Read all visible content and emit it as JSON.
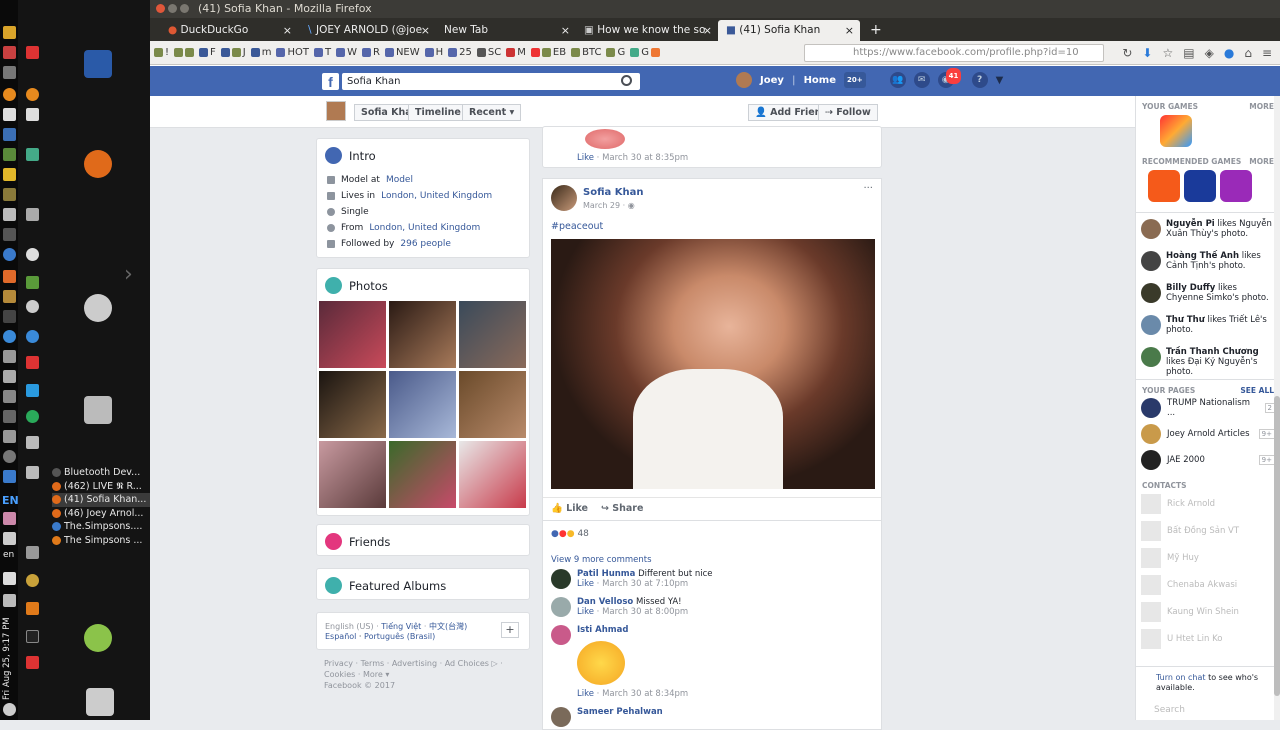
{
  "window": {
    "title": "(41) Sofia Khan - Mozilla Firefox"
  },
  "tabs": [
    {
      "label": "DuckDuckGo",
      "active": false
    },
    {
      "label": "JOEY ARNOLD (@joe",
      "active": false
    },
    {
      "label": "New Tab",
      "active": false
    },
    {
      "label": "How we know the so",
      "active": false
    },
    {
      "label": "(41) Sofia Khan",
      "active": true
    }
  ],
  "bookmarks": [
    "!",
    "F",
    "J",
    "m",
    "HOT",
    "T",
    "W",
    "R",
    "NEW",
    "H",
    "25",
    "SC",
    "M",
    "EB",
    "BTC",
    "G",
    "G"
  ],
  "url": {
    "host": "https://www.facebook.com",
    "path": "/profile.php?id=10"
  },
  "fb": {
    "search_value": "Sofia Khan",
    "user": "Joey",
    "home": "Home",
    "home_count": "20+",
    "notif_count": "41",
    "profile_name": "Sofia Khan",
    "timeline": "Timeline",
    "recent": "Recent",
    "add_friend": "Add Friend",
    "follow": "Follow"
  },
  "intro": {
    "title": "Intro",
    "rows": [
      {
        "pre": "Model at ",
        "link": "Model"
      },
      {
        "pre": "Lives in ",
        "link": "London, United Kingdom"
      },
      {
        "pre": "Single",
        "link": ""
      },
      {
        "pre": "From ",
        "link": "London, United Kingdom"
      },
      {
        "pre": "Followed by ",
        "link": "296 people"
      }
    ]
  },
  "photos": {
    "title": "Photos"
  },
  "friends": {
    "title": "Friends"
  },
  "albums": {
    "title": "Featured Albums"
  },
  "footer": {
    "langs": [
      "English (US)",
      "Tiếng Việt",
      "中文(台灣)",
      "Español",
      "Português (Brasil)"
    ],
    "plus": "+",
    "links": [
      "Privacy",
      "Terms",
      "Advertising",
      "Ad Choices",
      "Cookies",
      "More"
    ],
    "copyright": "Facebook © 2017"
  },
  "prev_post": {
    "like": "Like",
    "time": "March 30 at 8:35pm"
  },
  "post": {
    "author": "Sofia Khan",
    "date": "March 29",
    "more": "···",
    "hashtag": "#peaceout",
    "like": "Like",
    "share": "Share",
    "reaction_count": "48",
    "view_more": "View 9 more comments"
  },
  "comments": [
    {
      "name": "Patil Hunma",
      "text": "Different but nice",
      "like": "Like",
      "time": "March 30 at 7:10pm"
    },
    {
      "name": "Dan Velloso",
      "text": "Missed YA!",
      "like": "Like",
      "time": "March 30 at 8:00pm"
    },
    {
      "name": "Isti Ahmad",
      "text": "",
      "like": "Like",
      "time": "March 30 at 8:34pm"
    },
    {
      "name": "Sameer Pehalwan",
      "text": "",
      "like": "",
      "time": ""
    }
  ],
  "right": {
    "your_games": "YOUR GAMES",
    "more1": "MORE",
    "recommended": "RECOMMENDED GAMES",
    "more2": "MORE",
    "activity": [
      {
        "name": "Nguyễn Pi",
        "text": " likes Nguyễn Xuân Thùy's photo."
      },
      {
        "name": "Hoàng Thế Anh",
        "text": " likes Cảnh Tịnh's photo."
      },
      {
        "name": "Billy Duffy",
        "text": " likes Chyenne Simko's photo."
      },
      {
        "name": "Thư Thư",
        "text": " likes Triết Lê's photo."
      },
      {
        "name": "Trần Thanh Chương",
        "text": " likes Đại Kỷ Nguyễn's photo."
      }
    ],
    "your_pages": "YOUR PAGES",
    "see_all": "SEE ALL",
    "pages": [
      {
        "name": "TRUMP Nationalism ...",
        "count": "2"
      },
      {
        "name": "Joey Arnold Articles",
        "count": "9+"
      },
      {
        "name": "JAE 2000",
        "count": "9+"
      }
    ],
    "contacts_title": "CONTACTS",
    "contacts": [
      "Rick Arnold",
      "Bất Đồng Sản VT",
      "Mỹ Huy",
      "Chenaba Akwasi",
      "Kaung Win Shein",
      "U Htet Lin Ko"
    ],
    "chat_link": "Turn on chat",
    "chat_text": " to see who's available.",
    "search_placeholder": "Search"
  },
  "launcher": {
    "tasks": [
      "Bluetooth Dev...",
      "(462) LIVE 𝕹 R...",
      "(41) Sofia Khan...",
      "(46) Joey Arnol...",
      "The.Simpsons....",
      "The Simpsons ..."
    ],
    "lang": "EN",
    "en": "en",
    "clock": "Fri Aug 25,  9:17 PM"
  }
}
